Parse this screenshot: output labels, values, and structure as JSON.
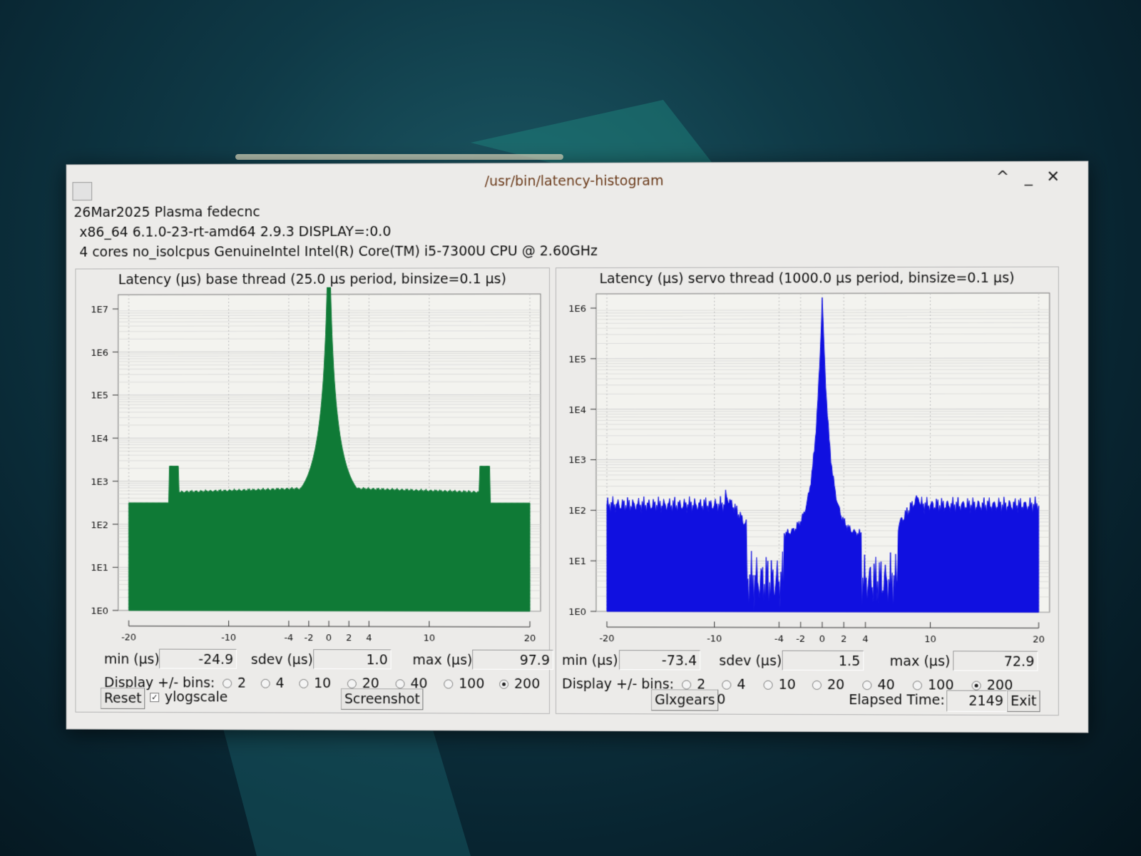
{
  "window": {
    "title": "/usr/bin/latency-histogram",
    "info_lines": [
      "26Mar2025 Plasma fedecnc",
      "x86_64  6.1.0-23-rt-amd64  2.9.3  DISPLAY=:0.0",
      "4 cores  no_isolcpus   GenuineIntel  Intel(R) Core(TM) i5-7300U CPU @ 2.60GHz"
    ],
    "controls": [
      "^",
      "_",
      "✕"
    ]
  },
  "panels": [
    {
      "title": "Latency (μs) base thread (25.0 μs period, binsize=0.1 μs)",
      "y_ticks": [
        "1E0",
        "1E1",
        "1E2",
        "1E3",
        "1E4",
        "1E5",
        "1E6",
        "1E7"
      ],
      "x_ticks": [
        "-20",
        "-10",
        "-4",
        "-2",
        "0",
        "2",
        "4",
        "10",
        "20"
      ],
      "stats": {
        "min_label": "min (μs)",
        "min_value": "-24.9",
        "sdev_label": "sdev (μs)",
        "sdev_value": "1.0",
        "max_label": "max (μs)",
        "max_value": "97.9"
      },
      "bins_label": "Display +/- bins:",
      "bin_options": [
        "2",
        "4",
        "10",
        "20",
        "40",
        "100",
        "200"
      ],
      "bin_selected": "200",
      "fill_color": "#0f7a36"
    },
    {
      "title": "Latency (μs) servo thread (1000.0 μs period, binsize=0.1 μs)",
      "y_ticks": [
        "1E0",
        "1E1",
        "1E2",
        "1E3",
        "1E4",
        "1E5",
        "1E6"
      ],
      "x_ticks": [
        "-20",
        "-10",
        "-4",
        "-2",
        "0",
        "2",
        "4",
        "10",
        "20"
      ],
      "stats": {
        "min_label": "min (μs)",
        "min_value": "-73.4",
        "sdev_label": "sdev (μs)",
        "sdev_value": "1.5",
        "max_label": "max (μs)",
        "max_value": "72.9"
      },
      "bins_label": "Display +/- bins:",
      "bin_options": [
        "2",
        "4",
        "10",
        "20",
        "40",
        "100",
        "200"
      ],
      "bin_selected": "200",
      "fill_color": "#1010e0"
    }
  ],
  "bottom": {
    "reset_label": "Reset",
    "ylogscale_label": "ylogscale",
    "ylogscale_checked": true,
    "screenshot_label": "Screenshot",
    "glxgears_label": "Glxgears",
    "glxgears_value": "0",
    "elapsed_label": "Elapsed Time:",
    "elapsed_value": "2149",
    "exit_label": "Exit"
  }
}
